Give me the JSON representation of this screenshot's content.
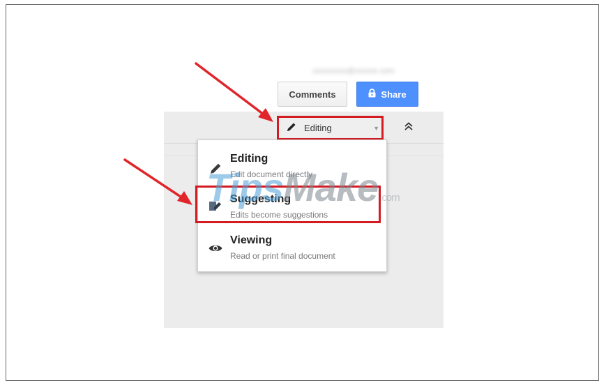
{
  "header": {
    "account_email": "xxxxxxxxx@xxxxxx.com",
    "comments_label": "Comments",
    "share_label": "Share"
  },
  "mode_button": {
    "label": "Editing"
  },
  "mode_menu": {
    "items": [
      {
        "title": "Editing",
        "description": "Edit document directly",
        "icon": "pencil-icon"
      },
      {
        "title": "Suggesting",
        "description": "Edits become suggestions",
        "icon": "suggest-edit-icon"
      },
      {
        "title": "Viewing",
        "description": "Read or print final document",
        "icon": "eye-icon"
      }
    ]
  },
  "watermark": {
    "text_part1": "Tips",
    "text_part2": "Make",
    "text_part3": ".com"
  },
  "colors": {
    "share_blue": "#4d90fe",
    "highlight_red": "#d31b22",
    "arrow_red": "#e0252b"
  }
}
